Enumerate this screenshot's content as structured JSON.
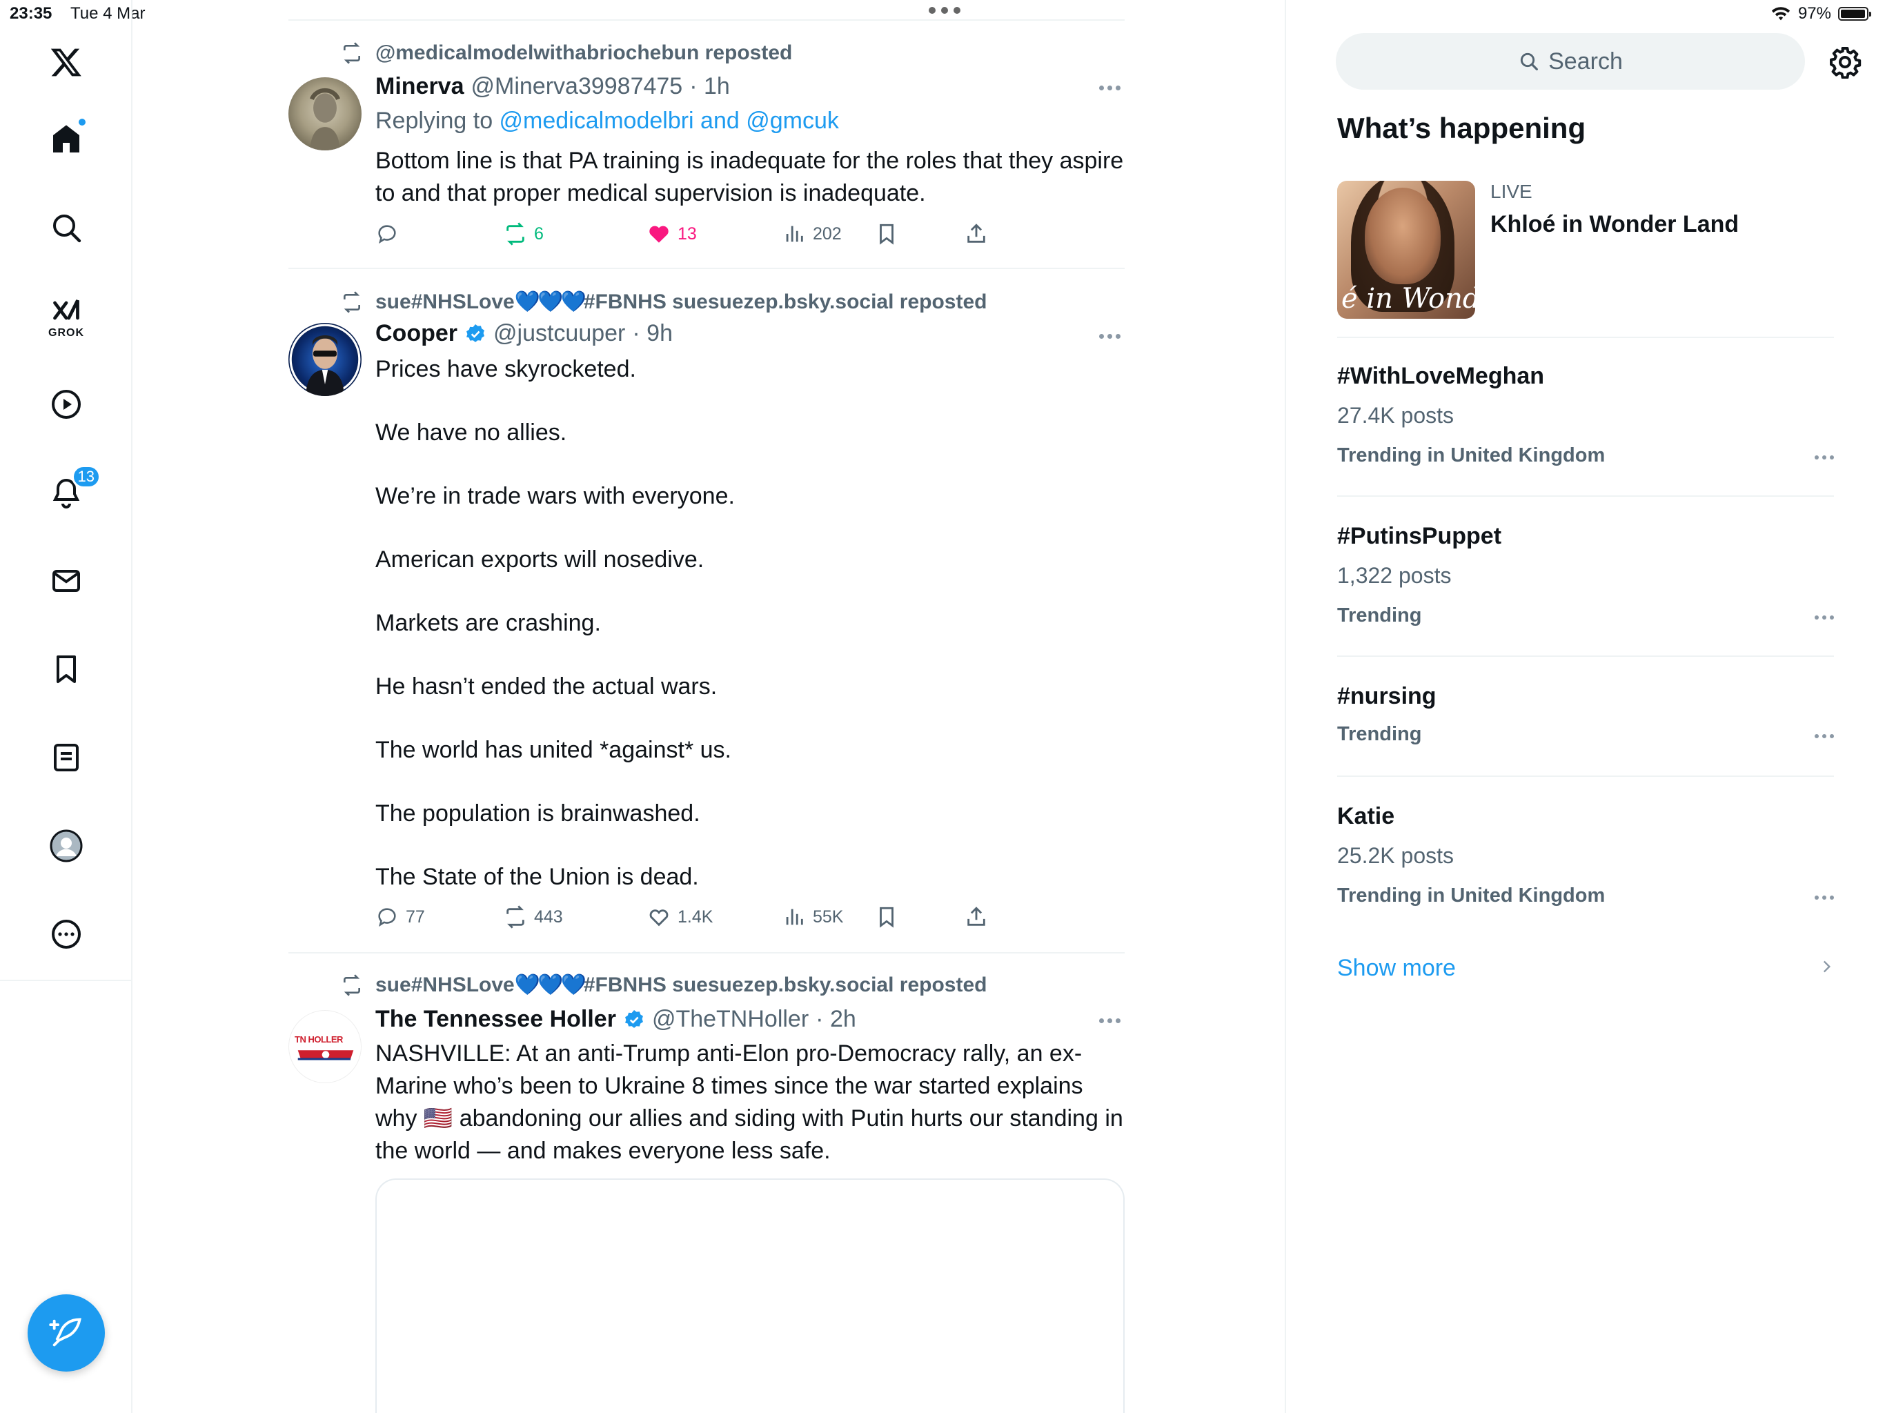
{
  "status_bar": {
    "time": "23:35",
    "date": "Tue 4 Mar",
    "battery": "97%",
    "battery_level": 0.97
  },
  "nav": {
    "grok_label": "GROK",
    "notifications_count": "13"
  },
  "tweets": [
    {
      "repost_by": "@medicalmodelwithabriochebun reposted",
      "name": "Minerva",
      "handle": "@Minerva39987475",
      "time": "· 1h",
      "replying_prefix": "Replying to ",
      "replying_users": "@medicalmodelbri and @gmcuk",
      "body": [
        "Bottom line is that PA training is inadequate for the roles that they aspire to and that proper medical supervision is inadequate."
      ],
      "replies": "",
      "reposts": "6",
      "likes": "13",
      "views": "202"
    },
    {
      "repost_prefix": "sue#NHSLove",
      "repost_hearts": "💙💙💙",
      "repost_suffix": "#FBNHS suesuezep.bsky.social reposted",
      "name": "Cooper",
      "handle": "@justcuuper",
      "time": "· 9h",
      "body": [
        "Prices have skyrocketed.",
        "We have no allies.",
        "We’re in trade wars with everyone.",
        "American exports will nosedive.",
        "Markets are crashing.",
        "He hasn’t ended the actual wars.",
        "The world has united *against* us.",
        "The population is brainwashed.",
        "The State of the Union is dead."
      ],
      "replies": "77",
      "reposts": "443",
      "likes": "1.4K",
      "views": "55K"
    },
    {
      "repost_prefix": "sue#NHSLove",
      "repost_hearts": "💙💙💙",
      "repost_suffix": "#FBNHS suesuezep.bsky.social reposted",
      "name": "The Tennessee Holler",
      "handle": "@TheTNHoller",
      "time": "· 2h",
      "avatar_text": "TN HOLLER",
      "body_part1": "NASHVILLE: At an anti-Trump anti-Elon pro-Democracy rally, an ex-Marine who’s been to Ukraine 8 times since the war started explains why ",
      "body_flag": "🇺🇸",
      "body_part2": " abandoning our allies and siding with Putin hurts our standing in the world — and makes everyone less safe."
    }
  ],
  "right": {
    "search_placeholder": "Search",
    "section_title": "What’s happening",
    "live": {
      "label": "LIVE",
      "title": "Khloé in Wonder Land",
      "thumb_text": "é in Wonder L"
    },
    "trends": [
      {
        "tag": "#WithLoveMeghan",
        "count": "27.4K posts",
        "context": "Trending in United Kingdom"
      },
      {
        "tag": "#PutinsPuppet",
        "count": "1,322 posts",
        "context": "Trending"
      },
      {
        "tag": "#nursing",
        "count": "",
        "context": "Trending"
      },
      {
        "tag": "Katie",
        "count": "25.2K posts",
        "context": "Trending in United Kingdom"
      }
    ],
    "show_more": "Show more"
  },
  "colors": {
    "accent": "#1d9bf0",
    "repost_green": "#00ba7c",
    "like_pink": "#f91880",
    "secondary_text": "#536471"
  },
  "icons": {
    "logo": "x-logo-icon",
    "home": "home-icon",
    "search": "search-icon",
    "grok": "grok-icon",
    "video": "play-icon",
    "notifications": "bell-icon",
    "messages": "envelope-icon",
    "bookmarks": "bookmark-icon",
    "lists": "list-icon",
    "profile": "profile-icon",
    "more": "more-circle-icon",
    "compose": "feather-icon",
    "settings": "gear-icon"
  }
}
